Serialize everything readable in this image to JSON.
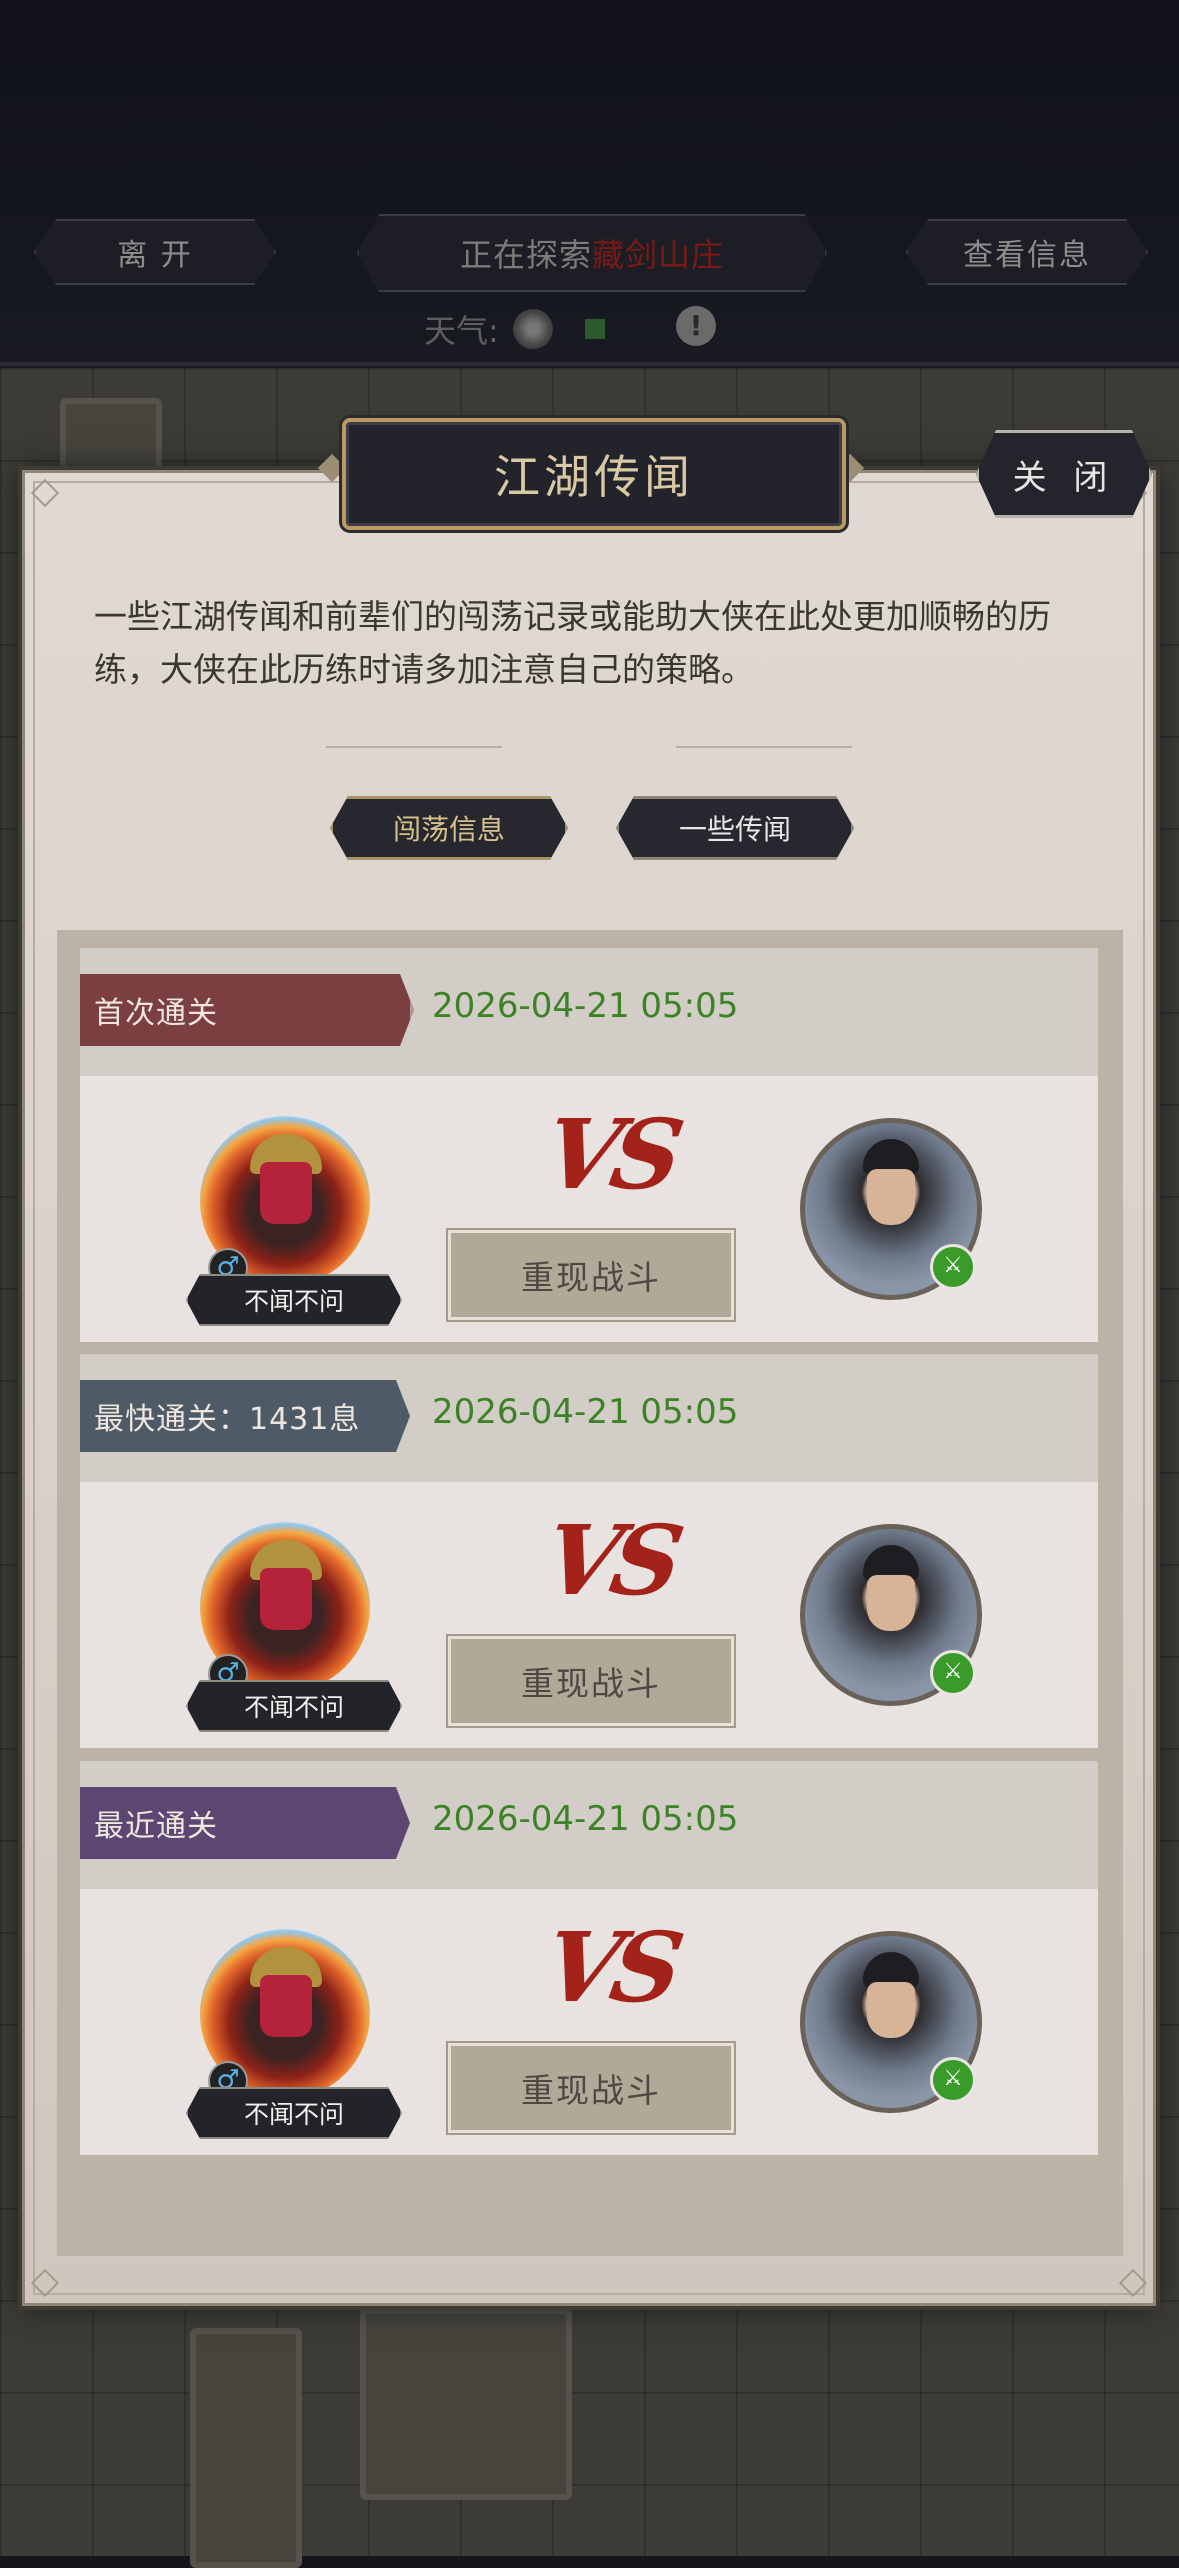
{
  "topbar": {
    "leave_label": "离 开",
    "explore_prefix": "正在探索",
    "explore_location": "藏剑山庄",
    "view_info_label": "查看信息",
    "weather_label": "天气:",
    "warning_glyph": "!"
  },
  "panel": {
    "title": "江湖传闻",
    "close_label": "关 闭",
    "description": "一些江湖传闻和前辈们的闯荡记录或能助大侠在此处更加顺畅的历练，大侠在此历练时请多加注意自己的策略。",
    "tabs": [
      {
        "label": "闯荡信息",
        "active": true
      },
      {
        "label": "一些传闻",
        "active": false
      }
    ]
  },
  "records": [
    {
      "tag": "首次通关",
      "tag_color": "#7c3f41",
      "date": "2026-04-21 05:05",
      "player_name": "不闻不问",
      "vs": "VS",
      "replay_label": "重现战斗"
    },
    {
      "tag": "最快通关：1431息",
      "tag_color": "#4e5b66",
      "date": "2026-04-21 05:05",
      "player_name": "不闻不问",
      "vs": "VS",
      "replay_label": "重现战斗"
    },
    {
      "tag": "最近通关",
      "tag_color": "#5b4771",
      "date": "2026-04-21 05:05",
      "player_name": "不闻不问",
      "vs": "VS",
      "replay_label": "重现战斗"
    }
  ],
  "icons": {
    "gender": "male-icon",
    "gender_glyph": "♂",
    "weapon": "sword-icon",
    "weapon_glyph": "⚔"
  },
  "colors": {
    "date_green": "#3d8227",
    "vs_red": "#a3231b",
    "location_red": "#7a1a14",
    "title_gold": "#d9c8a4"
  }
}
